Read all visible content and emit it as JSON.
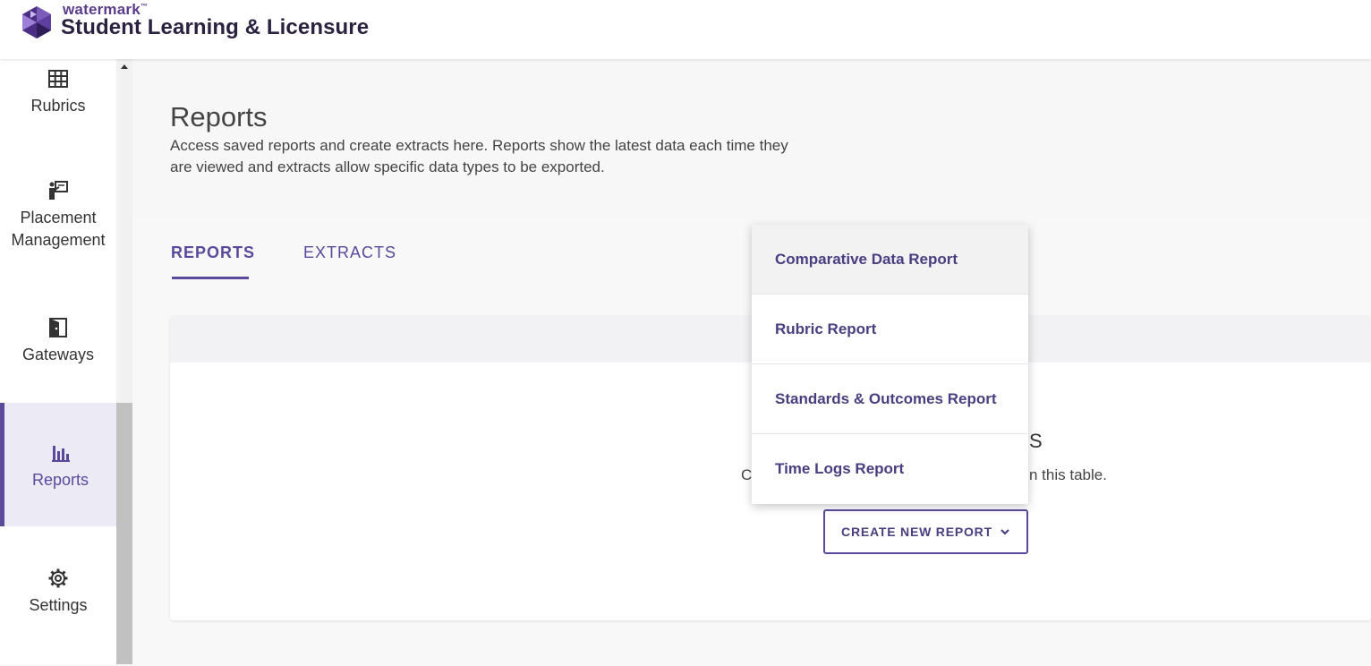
{
  "header": {
    "brand_small": "watermark",
    "brand_tm": "™",
    "brand_title": "Student Learning & Licensure"
  },
  "sidebar": {
    "items": [
      {
        "label": "Rubrics",
        "icon": "table-grid-icon"
      },
      {
        "label": "Placement Management",
        "icon": "presenter-board-icon"
      },
      {
        "label": "Gateways",
        "icon": "door-icon"
      },
      {
        "label": "Reports",
        "icon": "bar-chart-icon",
        "active": true
      },
      {
        "label": "Settings",
        "icon": "gear-icon"
      }
    ]
  },
  "main": {
    "title": "Reports",
    "description": "Access saved reports and create extracts here. Reports show the latest data each time they are viewed and extracts allow specific data types to be exported.",
    "tabs": [
      {
        "label": "REPORTS",
        "active": true
      },
      {
        "label": "EXTRACTS",
        "active": false
      }
    ],
    "empty_state": {
      "title_fragment": "S",
      "text_left": "C",
      "text_right": "n this table."
    },
    "create_button_label": "CREATE NEW REPORT"
  },
  "dropdown": {
    "items": [
      {
        "label": "Comparative Data Report",
        "hovered": true
      },
      {
        "label": "Rubric Report",
        "hovered": false
      },
      {
        "label": "Standards & Outcomes Report",
        "hovered": false
      },
      {
        "label": "Time Logs Report",
        "hovered": false
      }
    ]
  },
  "colors": {
    "accent": "#5b4a9b",
    "brand_dark": "#2b2240"
  }
}
